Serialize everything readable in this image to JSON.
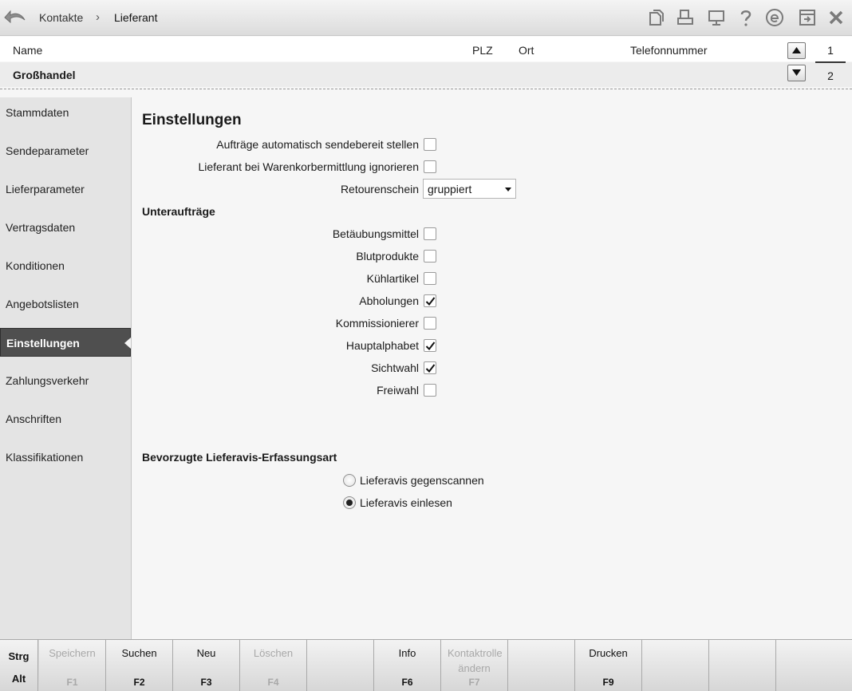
{
  "titlebar": {
    "breadcrumb": [
      "Kontakte",
      "Lieferant"
    ],
    "separator": "›",
    "icons": [
      "back-arrow-icon",
      "copy-icon",
      "print-icon",
      "monitor-icon",
      "help-icon",
      "e-icon",
      "window-icon",
      "close-icon"
    ]
  },
  "list": {
    "headers": {
      "name": "Name",
      "plz": "PLZ",
      "ort": "Ort",
      "telefon": "Telefonnummer"
    },
    "selected_row": {
      "name": "Großhandel"
    },
    "pages": [
      "1",
      "2"
    ]
  },
  "sidebar": {
    "items": [
      {
        "label": "Stammdaten",
        "active": false
      },
      {
        "label": "Sendeparameter",
        "active": false
      },
      {
        "label": "Lieferparameter",
        "active": false
      },
      {
        "label": "Vertragsdaten",
        "active": false
      },
      {
        "label": "Konditionen",
        "active": false
      },
      {
        "label": "Angebotslisten",
        "active": false
      },
      {
        "label": "Einstellungen",
        "active": true
      },
      {
        "label": "Zahlungsverkehr",
        "active": false
      },
      {
        "label": "Anschriften",
        "active": false
      },
      {
        "label": "Klassifikationen",
        "active": false
      }
    ]
  },
  "main": {
    "title": "Einstellungen",
    "settings": [
      {
        "label": "Aufträge automatisch sendebereit stellen",
        "checked": false
      },
      {
        "label": "Lieferant bei Warenkorbermittlung ignorieren",
        "checked": false
      }
    ],
    "retourenschein": {
      "label": "Retourenschein",
      "value": "gruppiert"
    },
    "unterauftraege_title": "Unteraufträge",
    "unterauftraege": [
      {
        "label": "Betäubungsmittel",
        "checked": false
      },
      {
        "label": "Blutprodukte",
        "checked": false
      },
      {
        "label": "Kühlartikel",
        "checked": false
      },
      {
        "label": "Abholungen",
        "checked": true
      },
      {
        "label": "Kommissionierer",
        "checked": false
      },
      {
        "label": "Hauptalphabet",
        "checked": true
      },
      {
        "label": "Sichtwahl",
        "checked": true
      },
      {
        "label": "Freiwahl",
        "checked": false
      }
    ],
    "lieferavis_title": "Bevorzugte Lieferavis-Erfassungsart",
    "lieferavis_options": [
      {
        "label": "Lieferavis gegenscannen",
        "selected": false
      },
      {
        "label": "Lieferavis einlesen",
        "selected": true
      }
    ]
  },
  "footer": {
    "modifiers": {
      "top": "Strg",
      "bottom": "Alt"
    },
    "keys": [
      {
        "label": "Speichern",
        "key": "F1",
        "enabled": false
      },
      {
        "label": "Suchen",
        "key": "F2",
        "enabled": true
      },
      {
        "label": "Neu",
        "key": "F3",
        "enabled": true
      },
      {
        "label": "Löschen",
        "key": "F4",
        "enabled": false
      },
      {
        "label": "",
        "key": "",
        "enabled": false
      },
      {
        "label": "Info",
        "key": "F6",
        "enabled": true
      },
      {
        "label": "Kontaktrolle ändern",
        "key": "F7",
        "enabled": false
      },
      {
        "label": "",
        "key": "",
        "enabled": false
      },
      {
        "label": "Drucken",
        "key": "F9",
        "enabled": true
      },
      {
        "label": "",
        "key": "",
        "enabled": false
      },
      {
        "label": "",
        "key": "",
        "enabled": false
      },
      {
        "label": "",
        "key": "",
        "enabled": false
      }
    ]
  }
}
